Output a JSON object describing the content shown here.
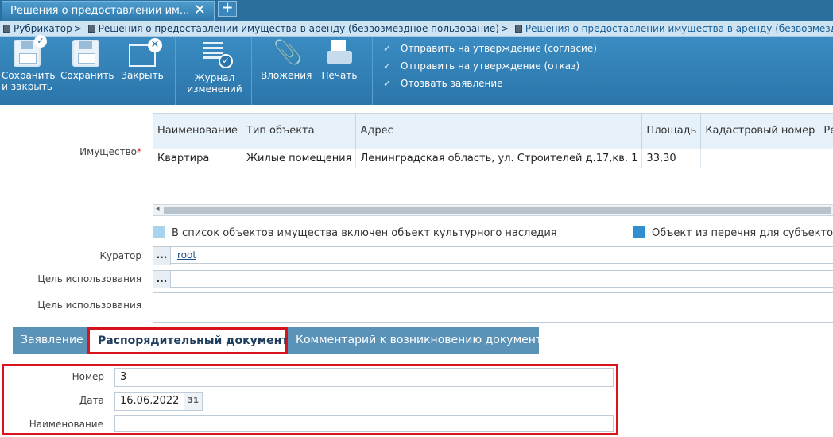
{
  "window": {
    "tab_title": "Решения о предоставлении им...",
    "close_glyph": "✕",
    "add_glyph": "+"
  },
  "breadcrumb": {
    "items": [
      "Рубрикатор",
      "Решения о предоставлении имущества в аренду (безвозмездное пользование)"
    ],
    "current": "Решения о предоставлении имущества в аренду (безвозмездное пользование)",
    "separator": ">"
  },
  "toolbar": {
    "save_close": "Сохранить и закрыть",
    "save": "Сохранить",
    "close": "Закрыть",
    "journal": "Журнал изменений",
    "attachments": "Вложения",
    "print": "Печать",
    "actions": [
      "Отправить на утверждение (согласие)",
      "Отправить на утверждение (отказ)",
      "Отозвать заявление"
    ]
  },
  "form": {
    "property_label": "Имущество",
    "required_mark": "*",
    "grid": {
      "columns": [
        "Наименование",
        "Тип объекта",
        "Адрес",
        "Площадь",
        "Кадастровый номер",
        "Реестр"
      ],
      "rows": [
        [
          "Квартира",
          "Жилые помещения",
          "Ленинградская область, ул. Строителей д.17,кв. 1",
          "33,30",
          "",
          ""
        ]
      ]
    },
    "legend_heritage": "В список объектов имущества включен объект культурного наследия",
    "legend_list": "Объект из перечня для субъектов МС",
    "curator_label": "Куратор",
    "curator_value": "root",
    "purpose_label_1": "Цель использования",
    "purpose_label_2": "Цель использования",
    "lookup_glyph": "..."
  },
  "tabs": [
    "Заявление",
    "Распорядительный документ",
    "Комментарий к возникновению документа"
  ],
  "document": {
    "number_label": "Номер",
    "number_value": "3",
    "date_label": "Дата",
    "date_value": "16.06.2022",
    "calendar_glyph": "31",
    "name_label": "Наименование",
    "name_value": ""
  },
  "colors": {
    "toolbar": "#2b75aa",
    "tab_inactive": "#5b93b8",
    "highlight": "#d7141b",
    "legend_heritage": "#a9d3ee",
    "legend_list": "#2f8fd0"
  }
}
